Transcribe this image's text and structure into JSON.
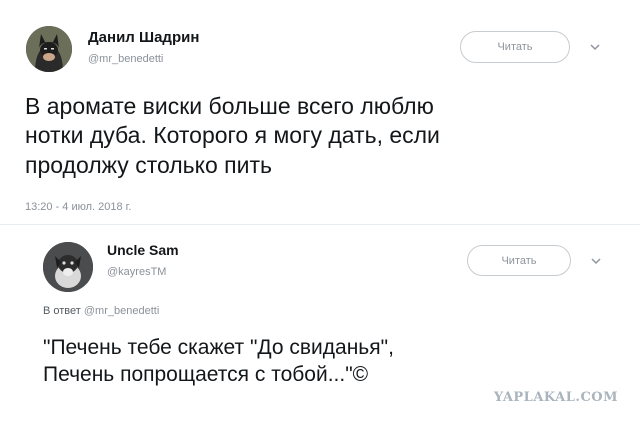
{
  "tweet1": {
    "display_name": "Данил Шадрин",
    "handle": "@mr_benedetti",
    "follow_label": "Читать",
    "text": "В аромате виски больше всего люблю\nнотки дуба. Которого я могу дать, если\nпродолжу столько пить",
    "timestamp": "13:20 - 4 июл. 2018 г."
  },
  "tweet2": {
    "display_name": "Uncle Sam",
    "handle": "@kayresTM",
    "follow_label": "Читать",
    "reply_prefix": "В ответ",
    "reply_mention": "@mr_benedetti",
    "text": "\"Печень тебе скажет \"До свиданья\",\nПечень попрощается с тобой...\"©"
  },
  "watermark": "YAPLAKAL.COM",
  "colors": {
    "text": "#14171a",
    "muted": "#8a9199",
    "button_border": "#c7ccd1"
  }
}
